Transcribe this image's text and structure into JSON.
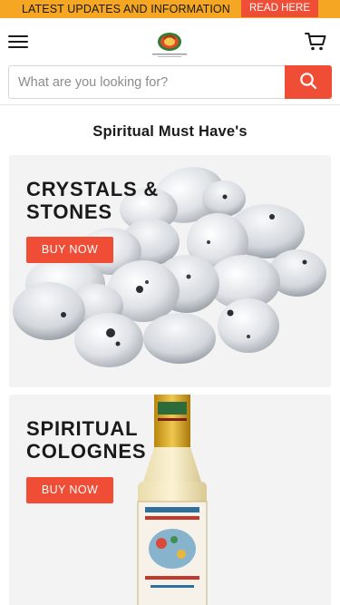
{
  "announcement": {
    "text": "LATEST UPDATES AND INFORMATION",
    "button_label": "READ HERE"
  },
  "header": {
    "logo_alt": "store logo",
    "menu_icon": "hamburger-menu-icon",
    "cart_icon": "shopping-cart-icon"
  },
  "search": {
    "placeholder": "What are you looking for?",
    "value": "",
    "button_icon": "search-icon"
  },
  "section": {
    "title": "Spiritual Must Have's"
  },
  "cards": [
    {
      "heading_line1": "CRYSTALS &",
      "heading_line2": "STONES",
      "button_label": "BUY NOW"
    },
    {
      "heading_line1": "SPIRITUAL",
      "heading_line2": "COLOGNES",
      "button_label": "BUY NOW"
    }
  ],
  "colors": {
    "announcement_bg": "#f5a623",
    "accent": "#ef4d36",
    "card_bg": "#f3f3f3"
  }
}
